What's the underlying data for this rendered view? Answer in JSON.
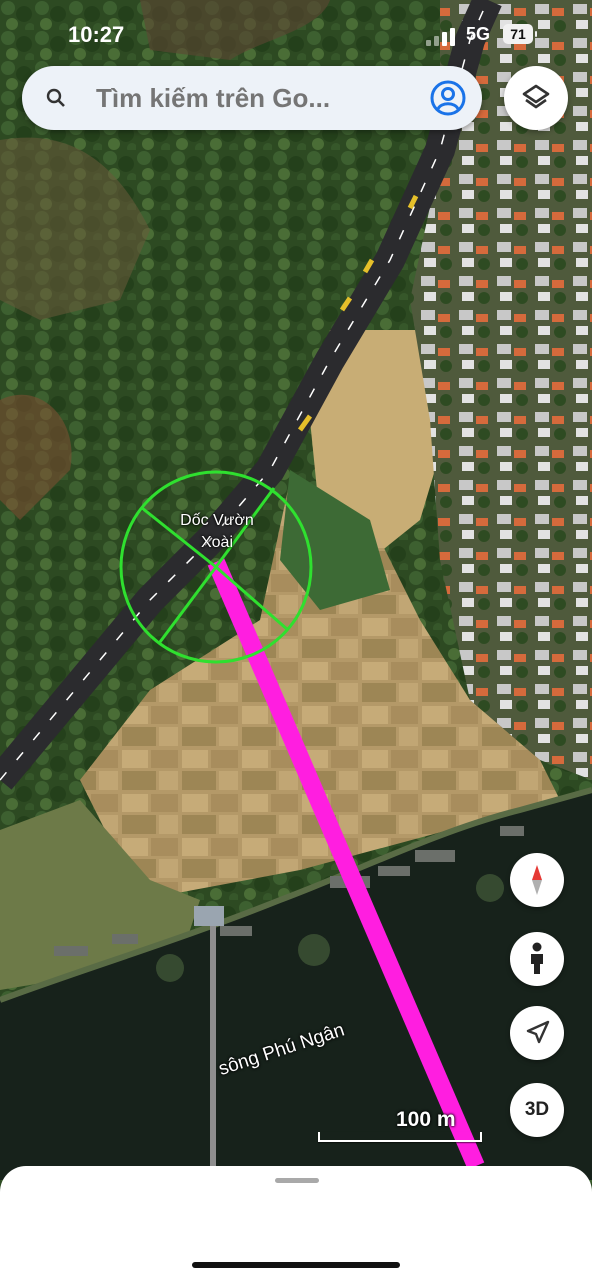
{
  "status_bar": {
    "time": "10:27",
    "network": "5G",
    "battery": "71"
  },
  "search": {
    "placeholder": "Tìm kiếm trên Go..."
  },
  "map": {
    "place_label": "Dốc Vườn\nXoài",
    "river_label": "sông Phú Ngân",
    "scale_label": "100 m"
  },
  "controls": {
    "three_d_label": "3D"
  },
  "colors": {
    "route": "#ff1ee0",
    "marker_circle": "#2fe02f",
    "accent_blue": "#1a73e8"
  },
  "icons": [
    "search-icon",
    "account-icon",
    "layers-icon",
    "compass-icon",
    "street-view-icon",
    "my-location-icon"
  ]
}
